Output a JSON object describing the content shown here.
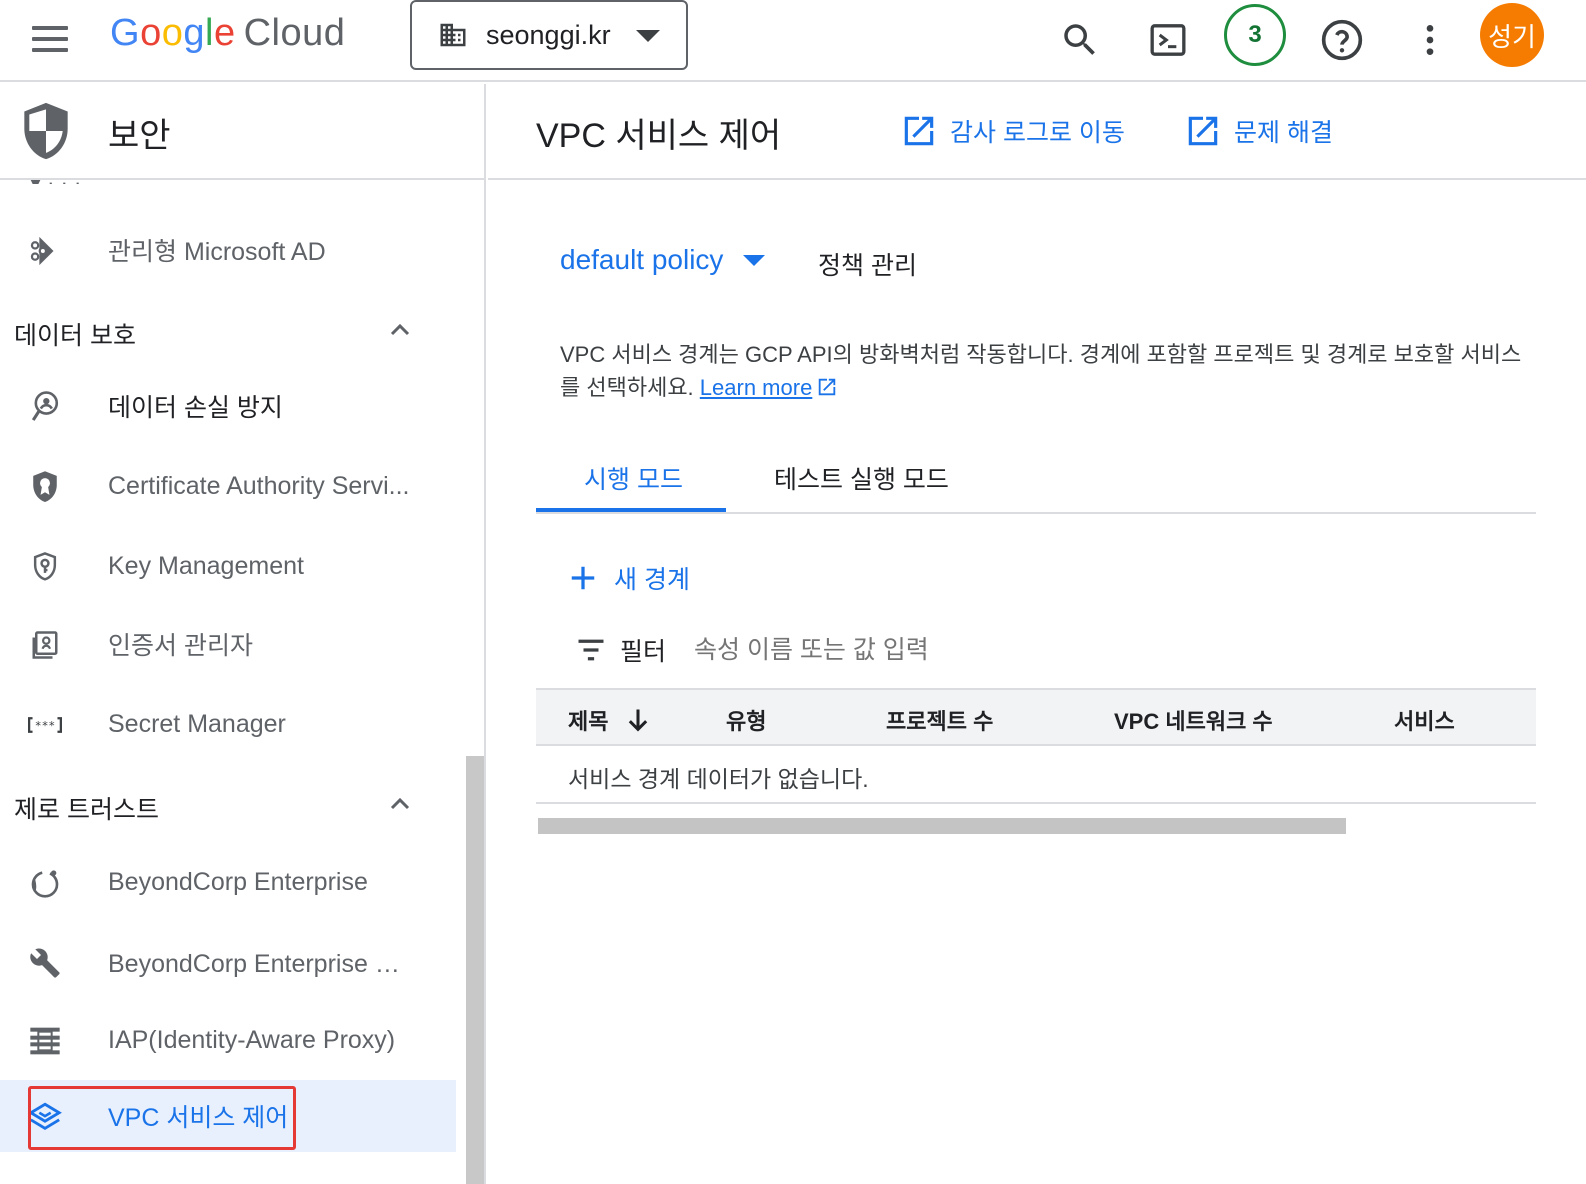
{
  "topbar": {
    "logo_letters": [
      "G",
      "o",
      "o",
      "g",
      "l",
      "e"
    ],
    "logo_cloud": "Cloud",
    "project_name": "seonggi.kr",
    "notification_count": "3",
    "avatar_initials": "성기",
    "icons": [
      "hamburger-menu-icon",
      "search-icon",
      "cloud-shell-icon",
      "help-icon",
      "more-vert-icon"
    ]
  },
  "sidebar": {
    "title": "보안",
    "items_top": [
      {
        "label": "관리형 Microsoft AD",
        "icon": "managed-ad-icon"
      }
    ],
    "sections": [
      {
        "label": "데이터 보호",
        "items": [
          {
            "label": "데이터 손실 방지",
            "icon": "dlp-icon"
          },
          {
            "label": "Certificate Authority Servi...",
            "icon": "certificate-authority-icon"
          },
          {
            "label": "Key Management",
            "icon": "key-management-icon"
          },
          {
            "label": "인증서 관리자",
            "icon": "certificate-manager-icon"
          },
          {
            "label": "Secret Manager",
            "icon": "secret-manager-icon"
          }
        ]
      },
      {
        "label": "제로 트러스트",
        "items": [
          {
            "label": "BeyondCorp Enterprise",
            "icon": "beyondcorp-icon"
          },
          {
            "label": "BeyondCorp Enterprise 정...",
            "icon": "wrench-icon"
          },
          {
            "label": "IAP(Identity-Aware Proxy)",
            "icon": "iap-icon"
          },
          {
            "label": "VPC 서비스 제어",
            "icon": "vpc-service-controls-icon",
            "active": true
          }
        ]
      }
    ]
  },
  "main": {
    "title": "VPC 서비스 제어",
    "header_links": [
      {
        "label": "감사 로그로 이동",
        "icon": "open-in-new-icon"
      },
      {
        "label": "문제 해결",
        "icon": "open-in-new-icon"
      }
    ],
    "policy": {
      "selected": "default policy",
      "manage_label": "정책 관리"
    },
    "description": "VPC 서비스 경계는 GCP API의 방화벽처럼 작동합니다. 경계에 포함할 프로젝트 및 경계로 보호할 서비스를 선택하세요.",
    "learn_more": "Learn more",
    "tabs": [
      {
        "label": "시행 모드",
        "active": true
      },
      {
        "label": "테스트 실행 모드",
        "active": false
      }
    ],
    "new_perimeter_label": "새 경계",
    "filter": {
      "label": "필터",
      "placeholder": "속성 이름 또는 값 입력"
    },
    "table": {
      "columns": [
        "제목",
        "유형",
        "프로젝트 수",
        "VPC 네트워크 수",
        "서비스"
      ],
      "sort_column": "제목",
      "sort_direction": "descending",
      "empty_message": "서비스 경계 데이터가 없습니다."
    }
  },
  "colors": {
    "accent": "#1a73e8",
    "active_bg": "#e8f0fe",
    "avatar_bg": "#f57c00",
    "badge_green": "#1e8e3e",
    "highlight_red": "#e53935"
  }
}
